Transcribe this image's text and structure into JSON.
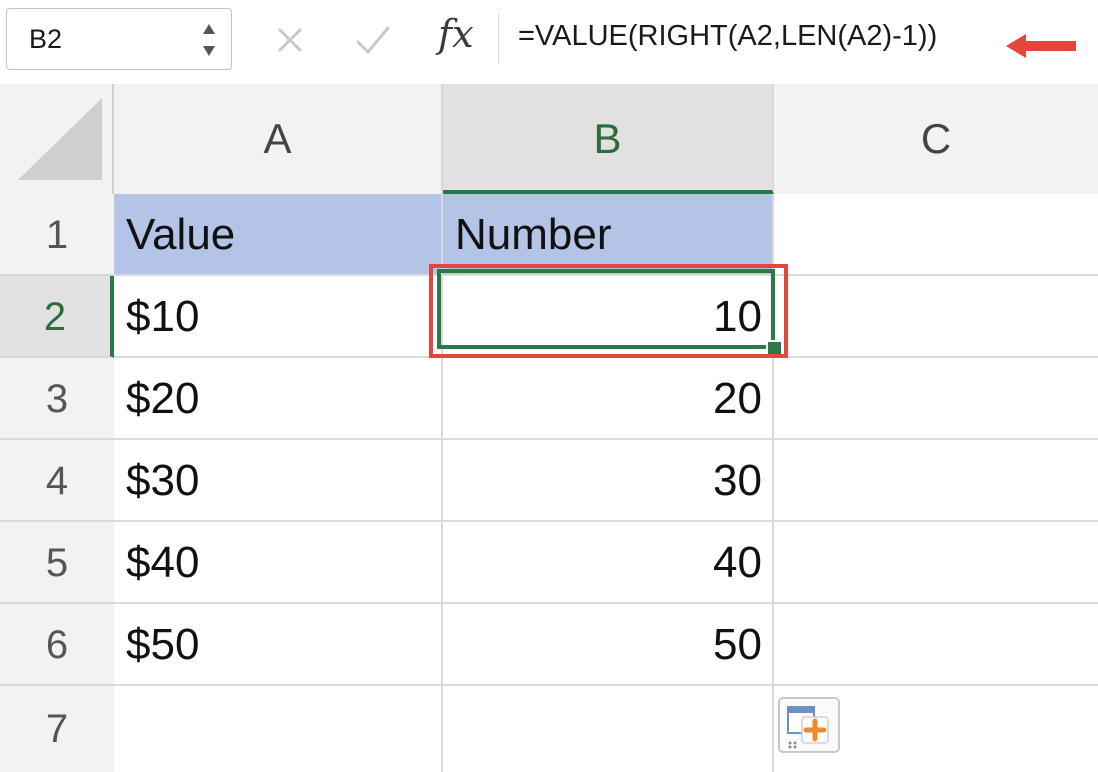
{
  "formula_bar": {
    "name_box": "B2",
    "fx_label": "fx",
    "formula": "=VALUE(RIGHT(A2,LEN(A2)-1))"
  },
  "columns": [
    "A",
    "B",
    "C"
  ],
  "selected_column": "B",
  "rows": [
    {
      "num": "1",
      "a": "Value",
      "b": "Number",
      "c": ""
    },
    {
      "num": "2",
      "a": "$10",
      "b": "10",
      "c": ""
    },
    {
      "num": "3",
      "a": "$20",
      "b": "20",
      "c": ""
    },
    {
      "num": "4",
      "a": "$30",
      "b": "30",
      "c": ""
    },
    {
      "num": "5",
      "a": "$40",
      "b": "40",
      "c": ""
    },
    {
      "num": "6",
      "a": "$50",
      "b": "50",
      "c": ""
    },
    {
      "num": "7",
      "a": "",
      "b": "",
      "c": ""
    }
  ],
  "selected_cell": "B2",
  "colors": {
    "header_fill": "#b4c4e6",
    "selection_green": "#2b7a46",
    "annotation_red": "#e2463d"
  },
  "icons": {
    "cancel": "close-icon",
    "enter": "checkmark-icon",
    "function": "fx-icon",
    "annotation": "arrow-left-icon",
    "paste_options": "paste-options-icon"
  }
}
